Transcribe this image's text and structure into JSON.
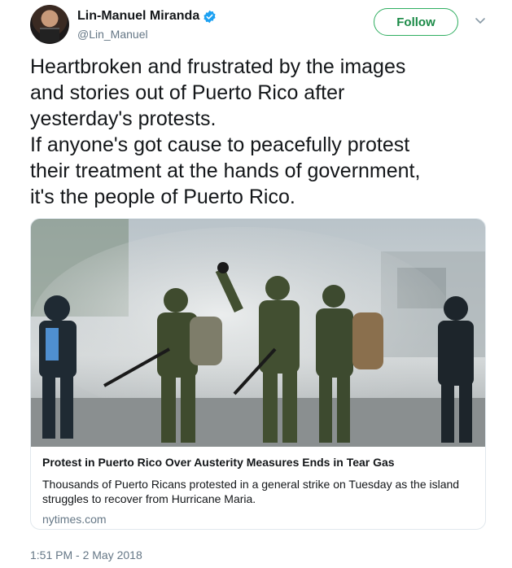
{
  "author": {
    "name": "Lin-Manuel Miranda",
    "handle": "@Lin_Manuel"
  },
  "follow_label": "Follow",
  "tweet": {
    "text": "Heartbroken and frustrated by the images\nand stories out of Puerto Rico after\nyesterday's protests.\nIf anyone's got cause to peacefully protest\ntheir treatment at the hands of government,\nit's the people of Puerto Rico."
  },
  "card": {
    "title": "Protest in Puerto Rico Over Austerity Measures Ends in Tear Gas",
    "description": "Thousands of Puerto Ricans protested in a general strike on Tuesday as the island struggles to recover from Hurricane Maria.",
    "domain": "nytimes.com"
  },
  "timestamp": "1:51 PM - 2 May 2018",
  "icons": {
    "verified": "verified-badge-icon",
    "caret": "chevron-down-icon"
  },
  "colors": {
    "follow_border": "#2fae60",
    "follow_text": "#1b8a47",
    "verified": "#1da1f2",
    "muted": "#657786",
    "text": "#14171a"
  }
}
